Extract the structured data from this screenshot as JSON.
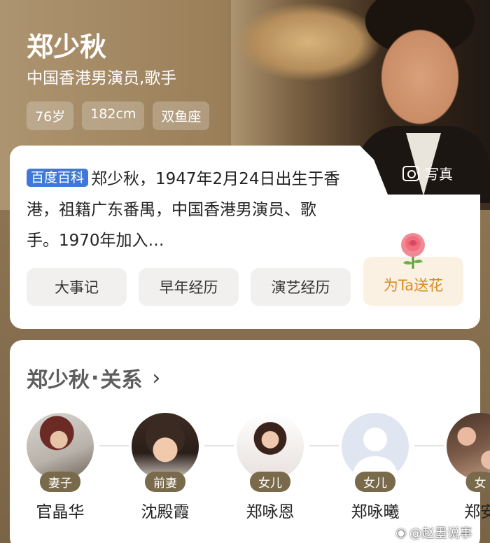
{
  "profile": {
    "name": "郑少秋",
    "subtitle": "中国香港男演员,歌手",
    "tags": [
      "76岁",
      "182cm",
      "双鱼座"
    ],
    "photo_label": "写真"
  },
  "intro": {
    "source_badge": "百度百科",
    "text": "郑少秋，1947年2月24日出生于香港，祖籍广东番禺，中国香港男演员、歌手。1970年加入…"
  },
  "chips": [
    "大事记",
    "早年经历",
    "演艺经历"
  ],
  "flower_button": "为Ta送花",
  "relations": {
    "title_name": "郑少秋",
    "title_dot": "·",
    "title_suffix": "关系",
    "chevron": "›",
    "people": [
      {
        "role": "妻子",
        "name": "官晶华"
      },
      {
        "role": "前妻",
        "name": "沈殿霞"
      },
      {
        "role": "女儿",
        "name": "郑咏恩"
      },
      {
        "role": "女儿",
        "name": "郑咏曦"
      },
      {
        "role": "女",
        "name": "郑安"
      }
    ]
  },
  "watermark": "@赵墨说事",
  "colors": {
    "accent_blue": "#3f78d8",
    "badge_brown": "#7a6a4c",
    "flower_orange": "#d78a23"
  }
}
